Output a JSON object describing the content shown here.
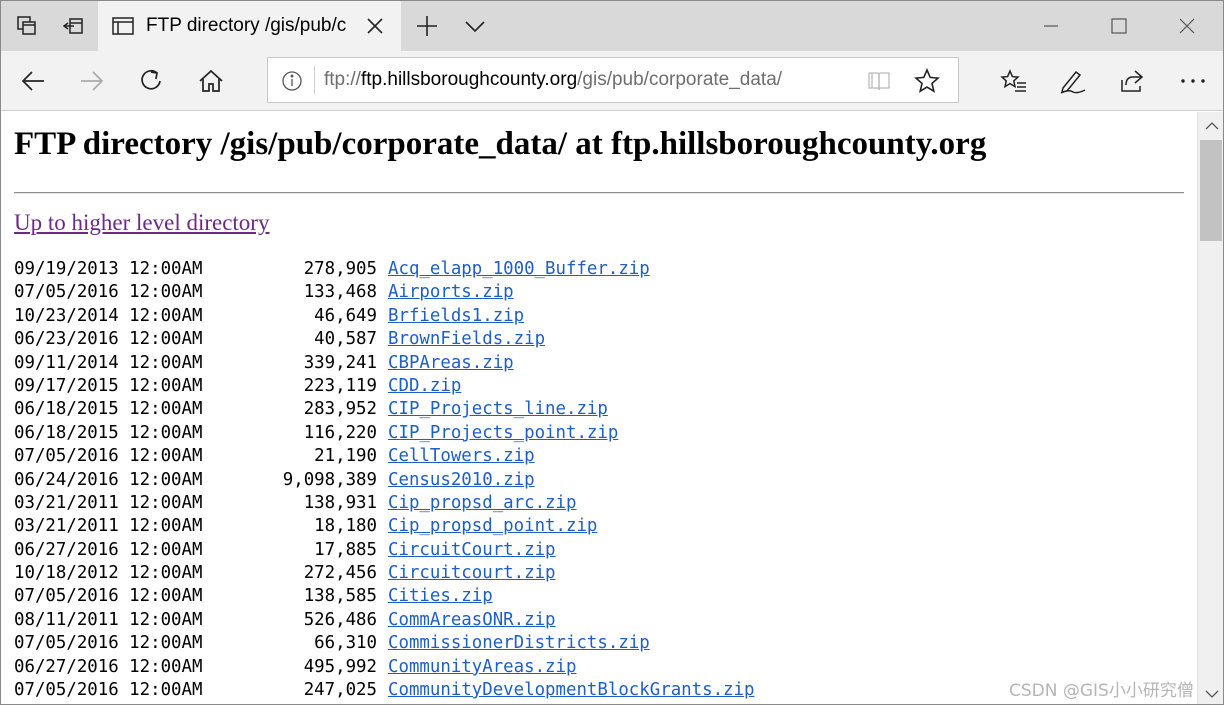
{
  "tab": {
    "title": "FTP directory /gis/pub/c"
  },
  "address": {
    "scheme": "ftp://",
    "host": "ftp.hillsboroughcounty.org",
    "path": "/gis/pub/corporate_data/"
  },
  "page": {
    "heading": "FTP directory /gis/pub/corporate_data/ at ftp.hillsboroughcounty.org",
    "up_link": "Up to higher level directory"
  },
  "files": [
    {
      "date": "09/19/2013 12:00AM",
      "size": "278,905",
      "name": "Acq_elapp_1000_Buffer.zip"
    },
    {
      "date": "07/05/2016 12:00AM",
      "size": "133,468",
      "name": "Airports.zip"
    },
    {
      "date": "10/23/2014 12:00AM",
      "size": "46,649",
      "name": "Brfields1.zip"
    },
    {
      "date": "06/23/2016 12:00AM",
      "size": "40,587",
      "name": "BrownFields.zip"
    },
    {
      "date": "09/11/2014 12:00AM",
      "size": "339,241",
      "name": "CBPAreas.zip"
    },
    {
      "date": "09/17/2015 12:00AM",
      "size": "223,119",
      "name": "CDD.zip"
    },
    {
      "date": "06/18/2015 12:00AM",
      "size": "283,952",
      "name": "CIP_Projects_line.zip"
    },
    {
      "date": "06/18/2015 12:00AM",
      "size": "116,220",
      "name": "CIP_Projects_point.zip"
    },
    {
      "date": "07/05/2016 12:00AM",
      "size": "21,190",
      "name": "CellTowers.zip"
    },
    {
      "date": "06/24/2016 12:00AM",
      "size": "9,098,389",
      "name": "Census2010.zip"
    },
    {
      "date": "03/21/2011 12:00AM",
      "size": "138,931",
      "name": "Cip_propsd_arc.zip"
    },
    {
      "date": "03/21/2011 12:00AM",
      "size": "18,180",
      "name": "Cip_propsd_point.zip"
    },
    {
      "date": "06/27/2016 12:00AM",
      "size": "17,885",
      "name": "CircuitCourt.zip"
    },
    {
      "date": "10/18/2012 12:00AM",
      "size": "272,456",
      "name": "Circuitcourt.zip"
    },
    {
      "date": "07/05/2016 12:00AM",
      "size": "138,585",
      "name": "Cities.zip"
    },
    {
      "date": "08/11/2011 12:00AM",
      "size": "526,486",
      "name": "CommAreasONR.zip"
    },
    {
      "date": "07/05/2016 12:00AM",
      "size": "66,310",
      "name": "CommissionerDistricts.zip"
    },
    {
      "date": "06/27/2016 12:00AM",
      "size": "495,992",
      "name": "CommunityAreas.zip"
    },
    {
      "date": "07/05/2016 12:00AM",
      "size": "247,025",
      "name": "CommunityDevelopmentBlockGrants.zip"
    }
  ],
  "watermark": "CSDN @GIS小小研究僧"
}
